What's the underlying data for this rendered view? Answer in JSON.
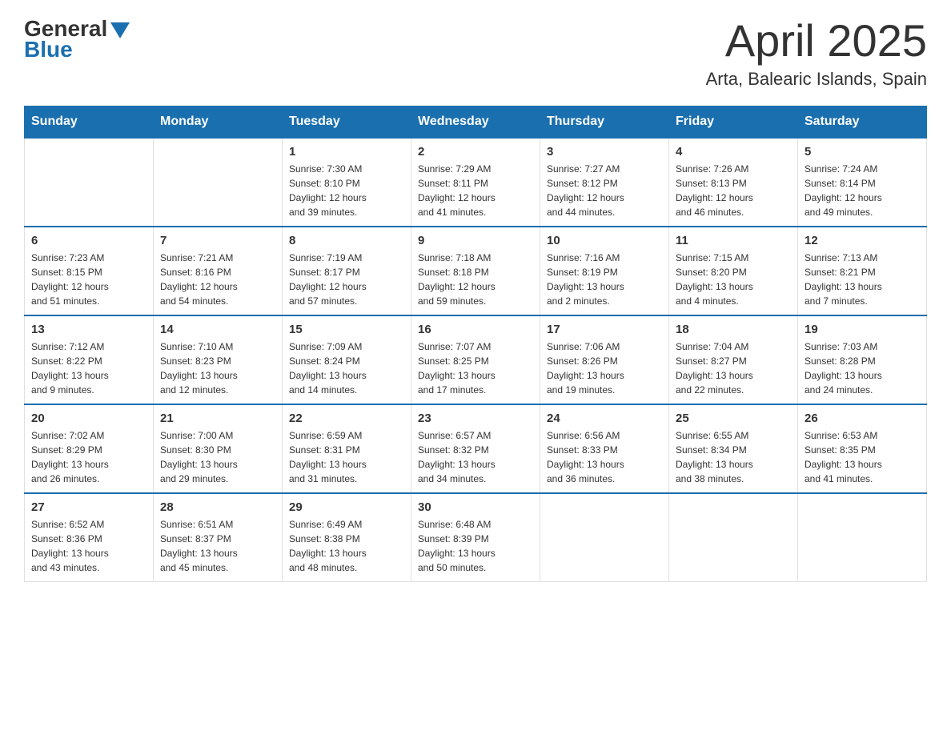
{
  "logo": {
    "general": "General",
    "blue": "Blue"
  },
  "title": "April 2025",
  "subtitle": "Arta, Balearic Islands, Spain",
  "weekdays": [
    "Sunday",
    "Monday",
    "Tuesday",
    "Wednesday",
    "Thursday",
    "Friday",
    "Saturday"
  ],
  "weeks": [
    [
      {
        "day": "",
        "info": ""
      },
      {
        "day": "",
        "info": ""
      },
      {
        "day": "1",
        "info": "Sunrise: 7:30 AM\nSunset: 8:10 PM\nDaylight: 12 hours\nand 39 minutes."
      },
      {
        "day": "2",
        "info": "Sunrise: 7:29 AM\nSunset: 8:11 PM\nDaylight: 12 hours\nand 41 minutes."
      },
      {
        "day": "3",
        "info": "Sunrise: 7:27 AM\nSunset: 8:12 PM\nDaylight: 12 hours\nand 44 minutes."
      },
      {
        "day": "4",
        "info": "Sunrise: 7:26 AM\nSunset: 8:13 PM\nDaylight: 12 hours\nand 46 minutes."
      },
      {
        "day": "5",
        "info": "Sunrise: 7:24 AM\nSunset: 8:14 PM\nDaylight: 12 hours\nand 49 minutes."
      }
    ],
    [
      {
        "day": "6",
        "info": "Sunrise: 7:23 AM\nSunset: 8:15 PM\nDaylight: 12 hours\nand 51 minutes."
      },
      {
        "day": "7",
        "info": "Sunrise: 7:21 AM\nSunset: 8:16 PM\nDaylight: 12 hours\nand 54 minutes."
      },
      {
        "day": "8",
        "info": "Sunrise: 7:19 AM\nSunset: 8:17 PM\nDaylight: 12 hours\nand 57 minutes."
      },
      {
        "day": "9",
        "info": "Sunrise: 7:18 AM\nSunset: 8:18 PM\nDaylight: 12 hours\nand 59 minutes."
      },
      {
        "day": "10",
        "info": "Sunrise: 7:16 AM\nSunset: 8:19 PM\nDaylight: 13 hours\nand 2 minutes."
      },
      {
        "day": "11",
        "info": "Sunrise: 7:15 AM\nSunset: 8:20 PM\nDaylight: 13 hours\nand 4 minutes."
      },
      {
        "day": "12",
        "info": "Sunrise: 7:13 AM\nSunset: 8:21 PM\nDaylight: 13 hours\nand 7 minutes."
      }
    ],
    [
      {
        "day": "13",
        "info": "Sunrise: 7:12 AM\nSunset: 8:22 PM\nDaylight: 13 hours\nand 9 minutes."
      },
      {
        "day": "14",
        "info": "Sunrise: 7:10 AM\nSunset: 8:23 PM\nDaylight: 13 hours\nand 12 minutes."
      },
      {
        "day": "15",
        "info": "Sunrise: 7:09 AM\nSunset: 8:24 PM\nDaylight: 13 hours\nand 14 minutes."
      },
      {
        "day": "16",
        "info": "Sunrise: 7:07 AM\nSunset: 8:25 PM\nDaylight: 13 hours\nand 17 minutes."
      },
      {
        "day": "17",
        "info": "Sunrise: 7:06 AM\nSunset: 8:26 PM\nDaylight: 13 hours\nand 19 minutes."
      },
      {
        "day": "18",
        "info": "Sunrise: 7:04 AM\nSunset: 8:27 PM\nDaylight: 13 hours\nand 22 minutes."
      },
      {
        "day": "19",
        "info": "Sunrise: 7:03 AM\nSunset: 8:28 PM\nDaylight: 13 hours\nand 24 minutes."
      }
    ],
    [
      {
        "day": "20",
        "info": "Sunrise: 7:02 AM\nSunset: 8:29 PM\nDaylight: 13 hours\nand 26 minutes."
      },
      {
        "day": "21",
        "info": "Sunrise: 7:00 AM\nSunset: 8:30 PM\nDaylight: 13 hours\nand 29 minutes."
      },
      {
        "day": "22",
        "info": "Sunrise: 6:59 AM\nSunset: 8:31 PM\nDaylight: 13 hours\nand 31 minutes."
      },
      {
        "day": "23",
        "info": "Sunrise: 6:57 AM\nSunset: 8:32 PM\nDaylight: 13 hours\nand 34 minutes."
      },
      {
        "day": "24",
        "info": "Sunrise: 6:56 AM\nSunset: 8:33 PM\nDaylight: 13 hours\nand 36 minutes."
      },
      {
        "day": "25",
        "info": "Sunrise: 6:55 AM\nSunset: 8:34 PM\nDaylight: 13 hours\nand 38 minutes."
      },
      {
        "day": "26",
        "info": "Sunrise: 6:53 AM\nSunset: 8:35 PM\nDaylight: 13 hours\nand 41 minutes."
      }
    ],
    [
      {
        "day": "27",
        "info": "Sunrise: 6:52 AM\nSunset: 8:36 PM\nDaylight: 13 hours\nand 43 minutes."
      },
      {
        "day": "28",
        "info": "Sunrise: 6:51 AM\nSunset: 8:37 PM\nDaylight: 13 hours\nand 45 minutes."
      },
      {
        "day": "29",
        "info": "Sunrise: 6:49 AM\nSunset: 8:38 PM\nDaylight: 13 hours\nand 48 minutes."
      },
      {
        "day": "30",
        "info": "Sunrise: 6:48 AM\nSunset: 8:39 PM\nDaylight: 13 hours\nand 50 minutes."
      },
      {
        "day": "",
        "info": ""
      },
      {
        "day": "",
        "info": ""
      },
      {
        "day": "",
        "info": ""
      }
    ]
  ]
}
